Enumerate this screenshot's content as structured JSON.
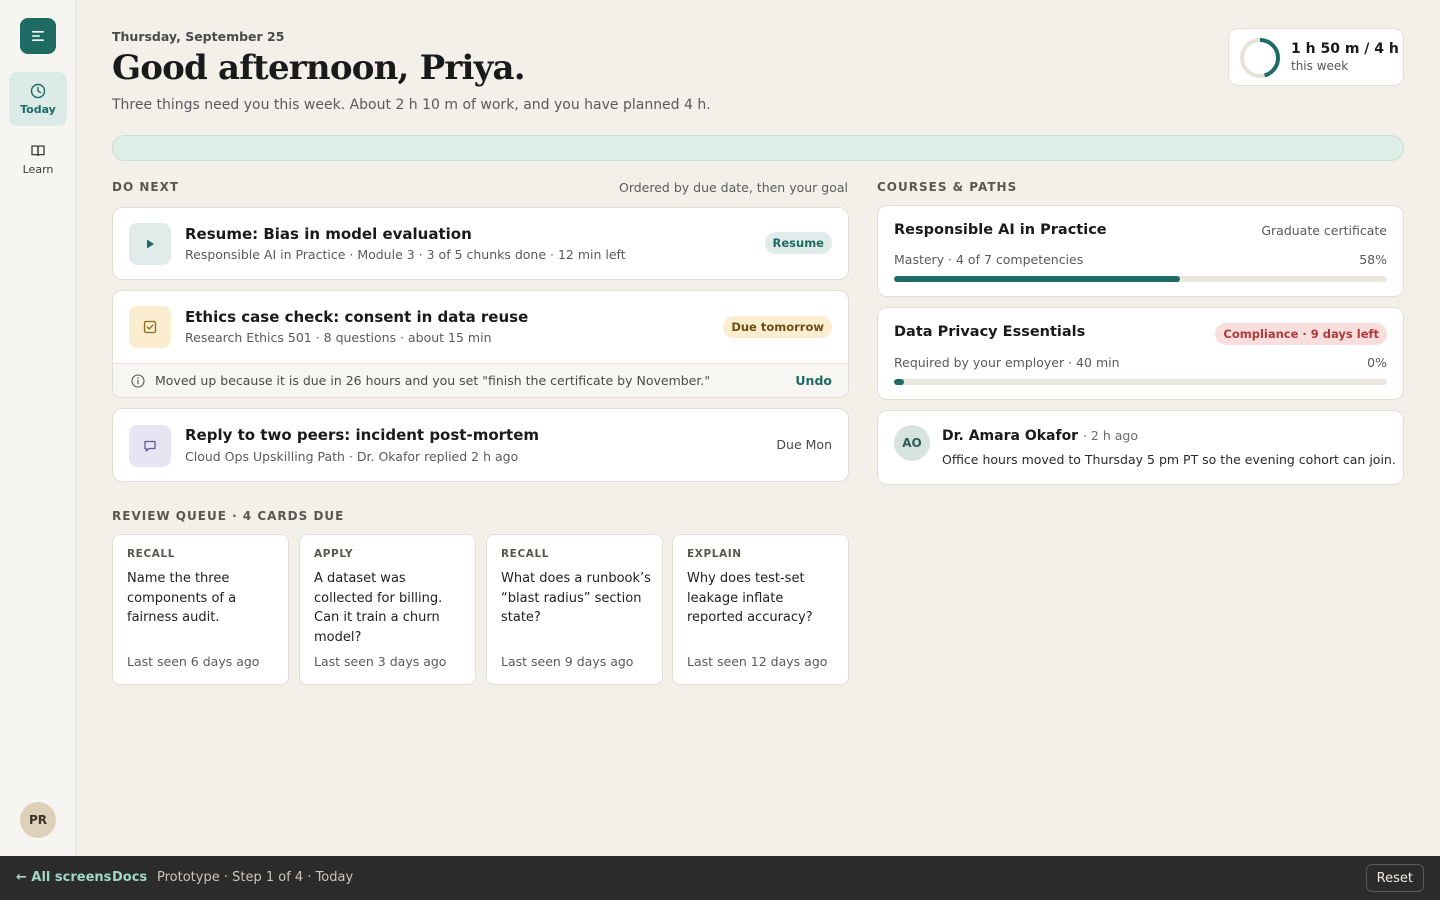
{
  "sidebar": {
    "items": [
      {
        "label": "Today",
        "icon": "clock-icon"
      },
      {
        "label": "Learn",
        "icon": "book-icon"
      }
    ],
    "user_initials": "PR"
  },
  "header": {
    "date": "Thursday, September 25",
    "greeting": "Good afternoon, Priya.",
    "subtitle": "Three things need you this week. About 2 h 10 m of work, and you have planned 4 h."
  },
  "time_widget": {
    "main": "1 h 50 m / 4 h",
    "sub": "this week",
    "progress": 0.458
  },
  "do_next": {
    "heading": "DO NEXT",
    "note": "Ordered by due date, then your goal",
    "tasks": [
      {
        "title": "Resume: Bias in model evaluation",
        "meta": "Responsible AI in Practice · Module 3 · 3 of 5 chunks done · 12 min left",
        "action": "Resume"
      },
      {
        "title": "Ethics case check: consent in data reuse",
        "meta": "Research Ethics 501 · 8 questions · about 15 min",
        "badge": "Due tomorrow",
        "note": "Moved up because it is due in 26 hours and you set \"finish the certificate by November.\"",
        "undo": "Undo"
      },
      {
        "title": "Reply to two peers: incident post-mortem",
        "meta": "Cloud Ops Upskilling Path · Dr. Okafor replied 2 h ago",
        "due": "Due Mon"
      }
    ]
  },
  "review": {
    "heading": "REVIEW QUEUE · 4 CARDS DUE",
    "cards": [
      {
        "kind": "RECALL",
        "question": "Name the three components of a fairness audit.",
        "seen": "Last seen 6 days ago"
      },
      {
        "kind": "APPLY",
        "question": "A dataset was collected for billing. Can it train a churn model?",
        "seen": "Last seen 3 days ago"
      },
      {
        "kind": "RECALL",
        "question": "What does a runbook’s “blast radius” section state?",
        "seen": "Last seen 9 days ago"
      },
      {
        "kind": "EXPLAIN",
        "question": "Why does test-set leakage inflate reported accuracy?",
        "seen": "Last seen 12 days ago"
      }
    ]
  },
  "courses": {
    "heading": "COURSES & PATHS",
    "items": [
      {
        "title": "Responsible AI in Practice",
        "tag": "Graduate certificate",
        "meta": "Mastery · 4 of 7 competencies",
        "pct": "58%",
        "progress": 0.58
      },
      {
        "title": "Data Privacy Essentials",
        "tag": "Compliance · 9 days left",
        "meta": "Required by your employer · 40 min",
        "pct": "0%",
        "progress": 0.02
      }
    ]
  },
  "message": {
    "initials": "AO",
    "name": "Dr. Amara Okafor",
    "time": "· 2 h ago",
    "body": "Office hours moved to Thursday 5 pm PT so the evening cohort can join."
  },
  "footer": {
    "all_screens": "← All screens",
    "docs": "Docs",
    "step": "Prototype · Step 1 of 4 · Today",
    "reset": "Reset"
  },
  "colors": {
    "accent": "#1d6b63",
    "background": "#f3f0ea",
    "warning_bg": "#fbedd0",
    "danger_bg": "#f9dede"
  }
}
